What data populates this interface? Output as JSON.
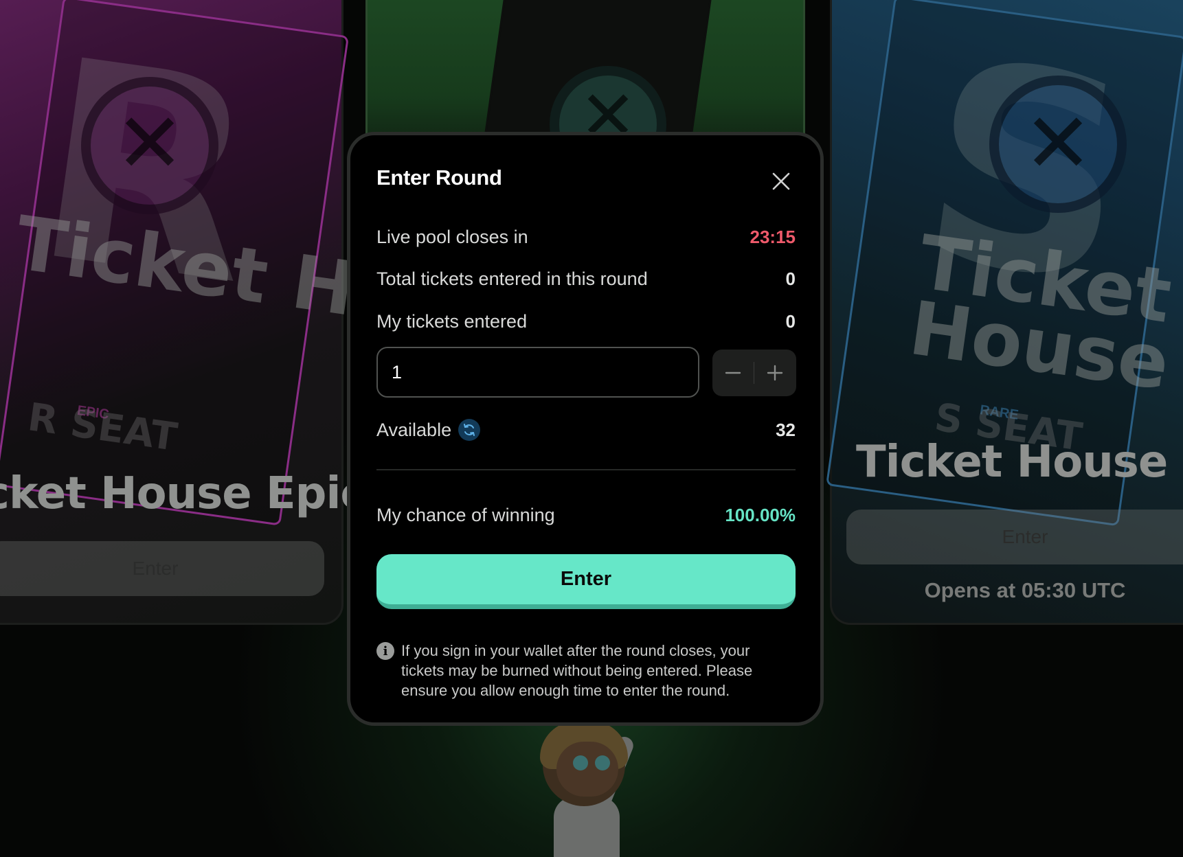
{
  "background": {
    "left_card": {
      "title": "cket House Epic",
      "enter_label": "Enter",
      "ticket_word": "Ticket House",
      "seat_label": "R SEAT",
      "rarity": "EPIC"
    },
    "right_card": {
      "title": "Ticket House Ra",
      "enter_label": "Enter",
      "opens_text": "Opens at 05:30 UTC",
      "ticket_word": "Ticket House",
      "seat_label": "S SEAT",
      "rarity": "RARE"
    }
  },
  "modal": {
    "title": "Enter Round",
    "rows": {
      "pool_closes_label": "Live pool closes in",
      "pool_closes_value": "23:15",
      "total_tickets_label": "Total tickets entered in this round",
      "total_tickets_value": "0",
      "my_tickets_label": "My tickets entered",
      "my_tickets_value": "0",
      "available_label": "Available",
      "available_value": "32",
      "chance_label": "My chance of winning",
      "chance_value": "100.00%"
    },
    "quantity_input_value": "1",
    "enter_button": "Enter",
    "notice": "If you sign in your wallet after the round closes, your tickets may be burned without being entered. Please ensure you allow enough time to enter the round."
  },
  "colors": {
    "accent": "#66e7c8",
    "timer_red": "#ef5a6b",
    "chance_green": "#66e3c5"
  }
}
